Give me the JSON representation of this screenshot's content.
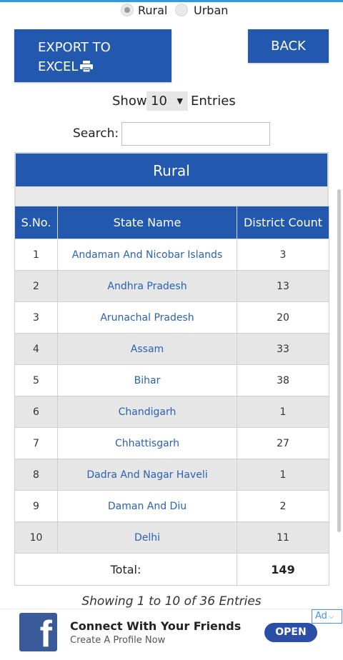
{
  "filter": {
    "options": [
      {
        "label": "Rural",
        "selected": true
      },
      {
        "label": "Urban",
        "selected": false
      }
    ]
  },
  "toolbar": {
    "export_line1": "EXPORT TO",
    "export_line2": "EXCEL",
    "export_icon": "printer-icon",
    "back_label": "BACK"
  },
  "entries": {
    "show_label": "Show",
    "value": "10",
    "entries_label": "Entries"
  },
  "search": {
    "label": "Search:",
    "value": "",
    "placeholder": ""
  },
  "table": {
    "caption": "Rural",
    "columns": [
      "S.No.",
      "State Name",
      "District Count"
    ],
    "rows": [
      {
        "sno": "1",
        "state": "Andaman And Nicobar Islands",
        "count": "3"
      },
      {
        "sno": "2",
        "state": "Andhra Pradesh",
        "count": "13"
      },
      {
        "sno": "3",
        "state": "Arunachal Pradesh",
        "count": "20"
      },
      {
        "sno": "4",
        "state": "Assam",
        "count": "33"
      },
      {
        "sno": "5",
        "state": "Bihar",
        "count": "38"
      },
      {
        "sno": "6",
        "state": "Chandigarh",
        "count": "1"
      },
      {
        "sno": "7",
        "state": "Chhattisgarh",
        "count": "27"
      },
      {
        "sno": "8",
        "state": "Dadra And Nagar Haveli",
        "count": "1"
      },
      {
        "sno": "9",
        "state": "Daman And Diu",
        "count": "2"
      },
      {
        "sno": "10",
        "state": "Delhi",
        "count": "11"
      }
    ],
    "total_label": "Total:",
    "total_value": "149"
  },
  "pagination": {
    "summary": "Showing 1 to 10 of 36 Entries"
  },
  "ad": {
    "icon": "facebook-icon",
    "title": "Connect With Your Friends",
    "subtitle": "Create A Profile Now",
    "cta": "OPEN",
    "badge": "Ad"
  },
  "colors": {
    "primary": "#2258ad",
    "link": "#2a62b5",
    "stripe": "#e6e6e6",
    "facebook": "#3a5a99"
  }
}
